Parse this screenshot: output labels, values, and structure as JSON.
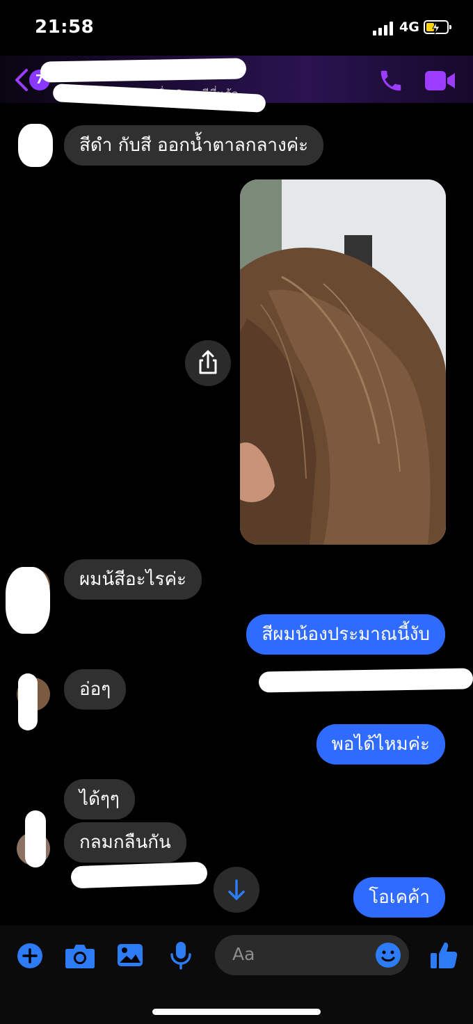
{
  "status": {
    "time": "21:58",
    "network": "4G"
  },
  "header": {
    "back_count": "7",
    "subtitle": "ใช้งานเมื่อ 8 นาทีที่แล้ว",
    "colors": {
      "accent": "#9b3cff"
    }
  },
  "messages": [
    {
      "side": "them",
      "text": "สีดำ กับสี ออกน้ำตาลกลางค่ะ"
    },
    {
      "side": "me",
      "type": "image",
      "alt_icon": "photo-hair"
    },
    {
      "side": "them",
      "text": "ผมน้สีอะไรค่ะ"
    },
    {
      "side": "me",
      "text": "สีผมน้องประมาณนี้งับ"
    },
    {
      "side": "them",
      "text": "อ่อๆ"
    },
    {
      "side": "me",
      "text": "พอได้ไหมค่ะ"
    },
    {
      "side": "them",
      "text": "ได้ๆๆ"
    },
    {
      "side": "them",
      "text": "กลมกลืนกัน"
    },
    {
      "side": "me",
      "text": "โอเคค้า"
    }
  ],
  "composer": {
    "placeholder": "Aa",
    "icons": [
      "plus-icon",
      "camera-icon",
      "gallery-icon",
      "microphone-icon",
      "emoji-icon",
      "thumbs-up-icon"
    ]
  },
  "colors": {
    "my_bubble": "#2f6bff",
    "their_bubble": "#303030",
    "tool_blue": "#2d7cf6"
  }
}
